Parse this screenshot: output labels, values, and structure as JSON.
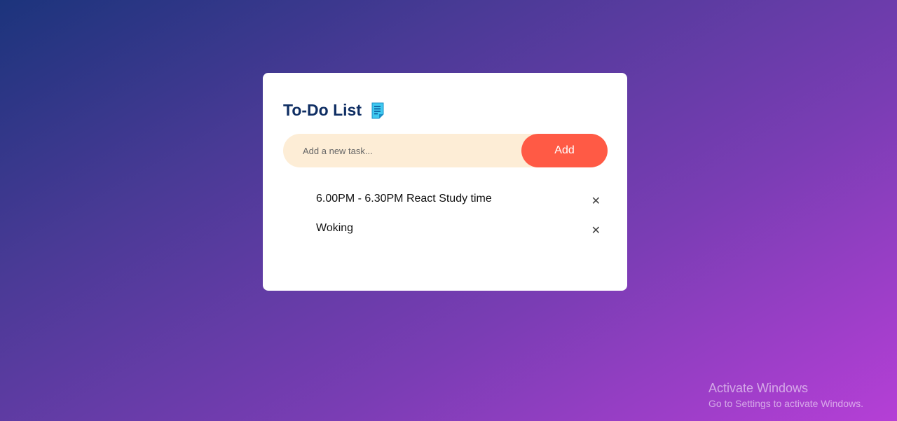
{
  "app": {
    "title": "To-Do List",
    "title_icon": "note-icon"
  },
  "input": {
    "placeholder": "Add a new task...",
    "value": ""
  },
  "add_button": {
    "label": "Add"
  },
  "tasks": [
    {
      "text": "6.00PM - 6.30PM React Study time",
      "remove_icon": "✕"
    },
    {
      "text": "Woking",
      "remove_icon": "✕"
    }
  ],
  "watermark": {
    "title": "Activate Windows",
    "subtitle": "Go to Settings to activate Windows."
  },
  "colors": {
    "accent": "#ff5a45",
    "input_bg": "#fdedd6",
    "title": "#0f2e63"
  }
}
